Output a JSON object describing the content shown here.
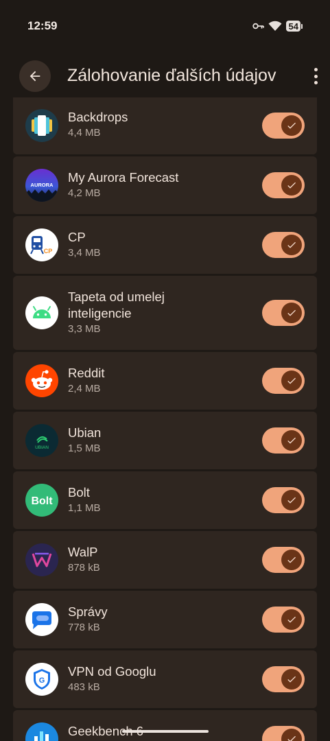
{
  "status": {
    "time": "12:59",
    "battery": "54"
  },
  "header": {
    "title": "Zálohovanie ďalších údajov"
  },
  "apps": [
    {
      "name": "Backdrops",
      "size": "4,4 MB",
      "icon": "backdrops-icon",
      "enabled": true
    },
    {
      "name": "My Aurora Forecast",
      "size": "4,2 MB",
      "icon": "aurora-icon",
      "icon_text": "AURORA",
      "enabled": true
    },
    {
      "name": "CP",
      "size": "3,4 MB",
      "icon": "cp-icon",
      "icon_text": "CP",
      "enabled": true
    },
    {
      "name": "Tapeta od umelej inteligencie",
      "size": "3,3 MB",
      "icon": "android-icon",
      "enabled": true
    },
    {
      "name": "Reddit",
      "size": "2,4 MB",
      "icon": "reddit-icon",
      "enabled": true
    },
    {
      "name": "Ubian",
      "size": "1,5 MB",
      "icon": "ubian-icon",
      "icon_text": "UBIAN",
      "enabled": true
    },
    {
      "name": "Bolt",
      "size": "1,1 MB",
      "icon": "bolt-icon",
      "icon_text": "Bolt",
      "enabled": true
    },
    {
      "name": "WalP",
      "size": "878 kB",
      "icon": "walp-icon",
      "enabled": true
    },
    {
      "name": "Správy",
      "size": "778 kB",
      "icon": "messages-icon",
      "enabled": true
    },
    {
      "name": "VPN od Googlu",
      "size": "483 kB",
      "icon": "vpn-icon",
      "icon_text": "G",
      "enabled": true
    },
    {
      "name": "Geekbench 6",
      "icon": "geekbench-icon",
      "enabled": true
    }
  ],
  "colors": {
    "background": "#1e1915",
    "card": "#2f2620",
    "toggle_track": "#f0a47b",
    "toggle_thumb": "#6a3417"
  }
}
